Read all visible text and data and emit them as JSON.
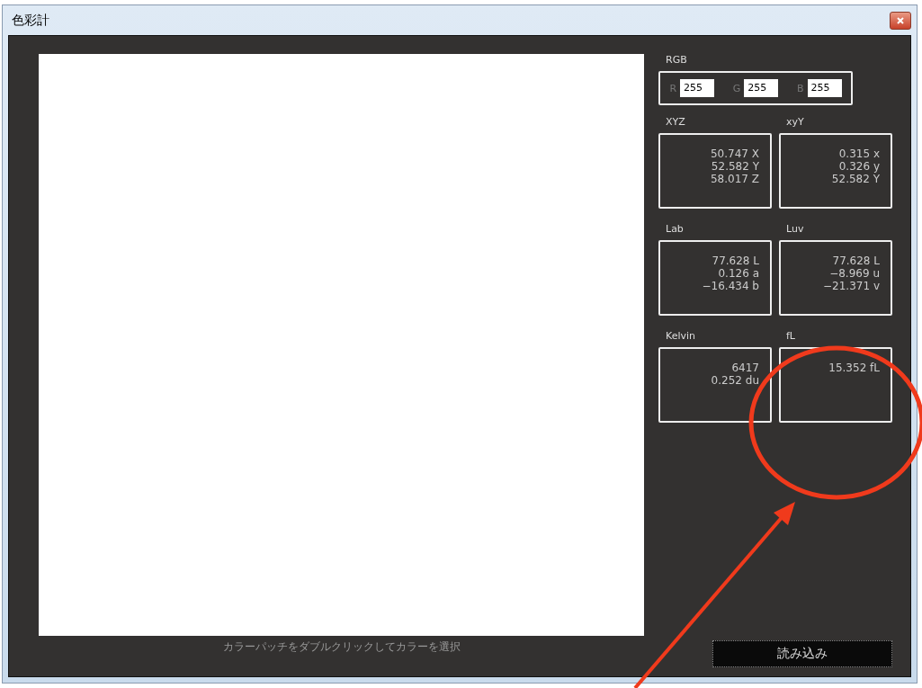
{
  "window": {
    "title": "色彩計"
  },
  "rgb": {
    "label": "RGB",
    "fields": [
      {
        "name": "R",
        "value": "255"
      },
      {
        "name": "G",
        "value": "255"
      },
      {
        "name": "B",
        "value": "255"
      }
    ]
  },
  "panels": [
    {
      "label": "XYZ",
      "lines": [
        "50.747 X",
        "52.582 Y",
        "58.017 Z"
      ]
    },
    {
      "label": "xyY",
      "lines": [
        "0.315 x",
        "0.326 y",
        "52.582 Y"
      ]
    },
    {
      "label": "Lab",
      "lines": [
        "77.628 L",
        "0.126 a",
        "−16.434 b"
      ]
    },
    {
      "label": "Luv",
      "lines": [
        "77.628 L",
        "−8.969 u",
        "−21.371 v"
      ]
    },
    {
      "label": "Kelvin",
      "lines": [
        "6417",
        "0.252 du"
      ]
    },
    {
      "label": "fL",
      "lines": [
        "15.352 fL"
      ]
    }
  ],
  "hint": "カラーパッチをダブルクリックしてカラーを選択",
  "load_button": "読み込み"
}
